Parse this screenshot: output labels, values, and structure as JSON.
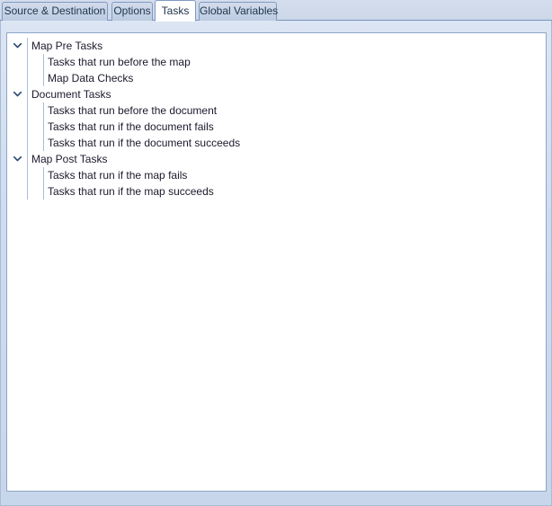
{
  "tabs": [
    {
      "id": "source-destination",
      "label": "Source & Destination",
      "active": false
    },
    {
      "id": "options",
      "label": "Options",
      "active": false
    },
    {
      "id": "tasks",
      "label": "Tasks",
      "active": true
    },
    {
      "id": "global-variables",
      "label": "Global Variables",
      "active": false
    }
  ],
  "tree": {
    "expander_icon": "chevron-down-icon",
    "groups": [
      {
        "id": "map-pre-tasks",
        "label": "Map Pre Tasks",
        "expanded": true,
        "children": [
          {
            "id": "tasks-before-map",
            "label": "Tasks that run before the map"
          },
          {
            "id": "map-data-checks",
            "label": "Map Data Checks"
          }
        ]
      },
      {
        "id": "document-tasks",
        "label": "Document Tasks",
        "expanded": true,
        "children": [
          {
            "id": "tasks-before-document",
            "label": "Tasks that run before the document"
          },
          {
            "id": "tasks-document-fails",
            "label": "Tasks that run if the document fails"
          },
          {
            "id": "tasks-document-succeeds",
            "label": "Tasks that run if the document succeeds"
          }
        ]
      },
      {
        "id": "map-post-tasks",
        "label": "Map Post Tasks",
        "expanded": true,
        "children": [
          {
            "id": "tasks-map-fails",
            "label": "Tasks that run if the map fails"
          },
          {
            "id": "tasks-map-succeeds",
            "label": "Tasks that run if the map succeeds"
          }
        ]
      }
    ]
  },
  "colors": {
    "accent": "#7f9ac1",
    "tabstrip_bg": "#ccd7e7",
    "panel_bg": "#cfdcef",
    "tree_bg": "#ffffff",
    "text": "#1a1a2e",
    "guide_line": "#aabdd6"
  }
}
